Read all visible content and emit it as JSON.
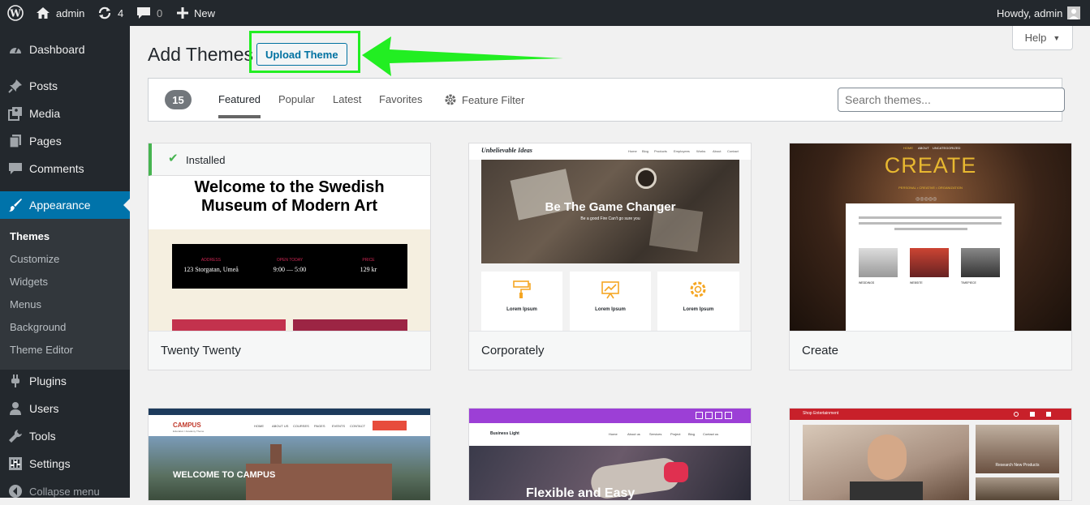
{
  "adminbar": {
    "site": "admin",
    "updates": "4",
    "comments": "0",
    "new": "New",
    "howdy": "Howdy, admin"
  },
  "sidebar": {
    "dashboard": "Dashboard",
    "posts": "Posts",
    "media": "Media",
    "pages": "Pages",
    "comments": "Comments",
    "appearance": "Appearance",
    "sub": [
      "Themes",
      "Customize",
      "Widgets",
      "Menus",
      "Background",
      "Theme Editor"
    ],
    "plugins": "Plugins",
    "users": "Users",
    "tools": "Tools",
    "settings": "Settings",
    "collapse": "Collapse menu"
  },
  "header": {
    "title": "Add Themes",
    "upload": "Upload Theme",
    "help": "Help"
  },
  "filter": {
    "count": "15",
    "tabs": [
      "Featured",
      "Popular",
      "Latest",
      "Favorites"
    ],
    "feature_filter": "Feature Filter",
    "search_placeholder": "Search themes..."
  },
  "themes": [
    {
      "name": "Twenty Twenty",
      "installed": "Installed",
      "headline1": "Welcome to the Swedish",
      "headline2": "Museum of Modern Art",
      "info": [
        {
          "label": "ADDRESS",
          "value": "123 Storgatan, Umeå"
        },
        {
          "label": "OPEN TODAY",
          "value": "9:00 — 5:00"
        },
        {
          "label": "PRICE",
          "value": "129 kr"
        }
      ]
    },
    {
      "name": "Corporately",
      "brand": "Unbelievable Ideas",
      "nav": [
        "Home",
        "Blog",
        "Products",
        "Employees",
        "Works",
        "About",
        "Contact"
      ],
      "hero": "Be The Game Changer",
      "hero_sub": "Be a good Fire Can't go sure you",
      "cards": [
        "Lorem Ipsum",
        "Lorem Ipsum",
        "Lorem Ipsum"
      ]
    },
    {
      "name": "Create",
      "nav": [
        "HOME",
        "ABOUT",
        "UNCATEGORIZED"
      ],
      "hero": "CREATE",
      "tagline": "PERSONAL • CREATIVE • ORGANIZATION",
      "items": [
        "WEDDINGS",
        "WEBSITE",
        "TIMEPIECE"
      ]
    },
    {
      "name": "Campus",
      "logo": "CAMPUS",
      "logo_sub": "Education / Academy Theme",
      "nav": [
        "HOME",
        "ABOUT US",
        "COURSES",
        "PAGES",
        "EVENTS",
        "CONTACT"
      ],
      "hero": "WELCOME TO CAMPUS"
    },
    {
      "name": "Business Light",
      "brand": "Business Light",
      "nav": [
        "Home",
        "About us",
        "Services",
        "Project",
        "Blog",
        "Contact us"
      ],
      "hero": "Flexible and Easy"
    },
    {
      "name": "Shop Entertainment",
      "brand": "Shop Entertainment",
      "promo": "Research New Products"
    }
  ],
  "colors": {
    "accent": "#0073aa",
    "arrow": "#22ee22",
    "sidebar": "#23282d"
  }
}
